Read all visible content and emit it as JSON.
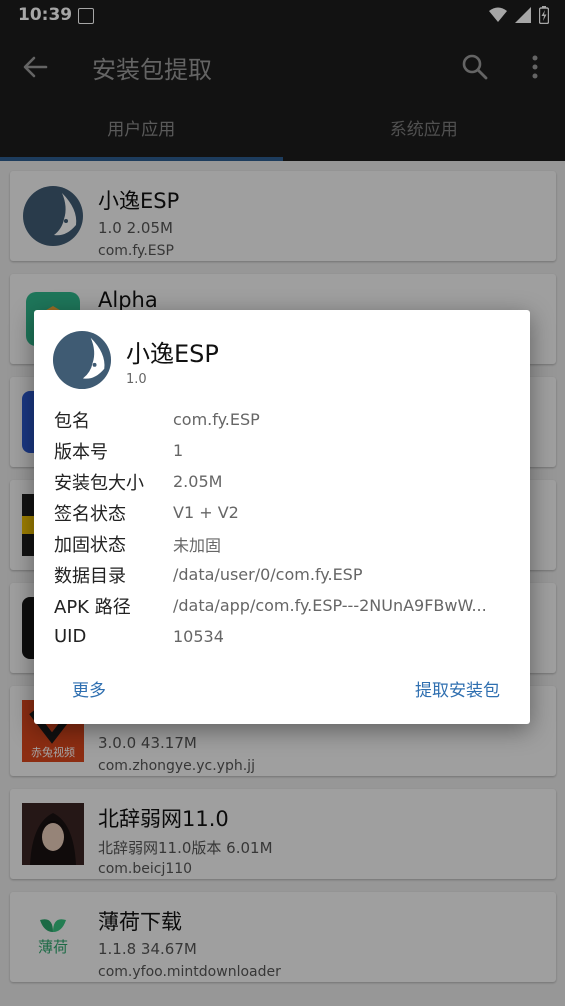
{
  "status_bar": {
    "time": "10:39"
  },
  "app_bar": {
    "title": "安装包提取"
  },
  "tabs": [
    {
      "label": "用户应用",
      "active": true
    },
    {
      "label": "系统应用",
      "active": false
    }
  ],
  "apps": [
    {
      "name": "小逸ESP",
      "meta": "1.0   2.05M",
      "package": "com.fy.ESP",
      "icon": "esp-app-icon"
    },
    {
      "name": "Alpha",
      "meta": "",
      "package": "",
      "icon": "alpha-app-icon"
    },
    {
      "name": "",
      "meta": "",
      "package": "",
      "icon": "blue-app-icon"
    },
    {
      "name": "",
      "meta": "",
      "package": "",
      "icon": "hd-app-icon"
    },
    {
      "name": "",
      "meta": "",
      "package": "",
      "icon": "dark-app-icon"
    },
    {
      "name": "",
      "meta": "3.0.0   43.17M",
      "package": "com.zhongye.yc.yph.jj",
      "icon": "red-video-app-icon",
      "icon_text": "赤兔视频"
    },
    {
      "name": "北辞弱网11.0",
      "meta": "北辞弱网11.0版本   6.01M",
      "package": "com.beicj110",
      "icon": "anime-app-icon"
    },
    {
      "name": "薄荷下载",
      "meta": "1.1.8   34.67M",
      "package": "com.yfoo.mintdownloader",
      "icon": "mint-app-icon",
      "icon_text": "薄荷"
    }
  ],
  "dialog": {
    "name": "小逸ESP",
    "version": "1.0",
    "rows": [
      {
        "key": "包名",
        "value": "com.fy.ESP"
      },
      {
        "key": "版本号",
        "value": "1"
      },
      {
        "key": "安装包大小",
        "value": "2.05M"
      },
      {
        "key": "签名状态",
        "value": "V1 + V2"
      },
      {
        "key": "加固状态",
        "value": "未加固"
      },
      {
        "key": "数据目录",
        "value": "/data/user/0/com.fy.ESP"
      },
      {
        "key": "APK 路径",
        "value": "/data/app/com.fy.ESP---2NUnA9FBwW..."
      },
      {
        "key": "UID",
        "value": "10534"
      }
    ],
    "more_label": "更多",
    "extract_label": "提取安装包"
  },
  "colors": {
    "accent": "#2f6fb0",
    "tab_indicator": "#2d5d8f",
    "app_bar": "#1d1d1d"
  }
}
